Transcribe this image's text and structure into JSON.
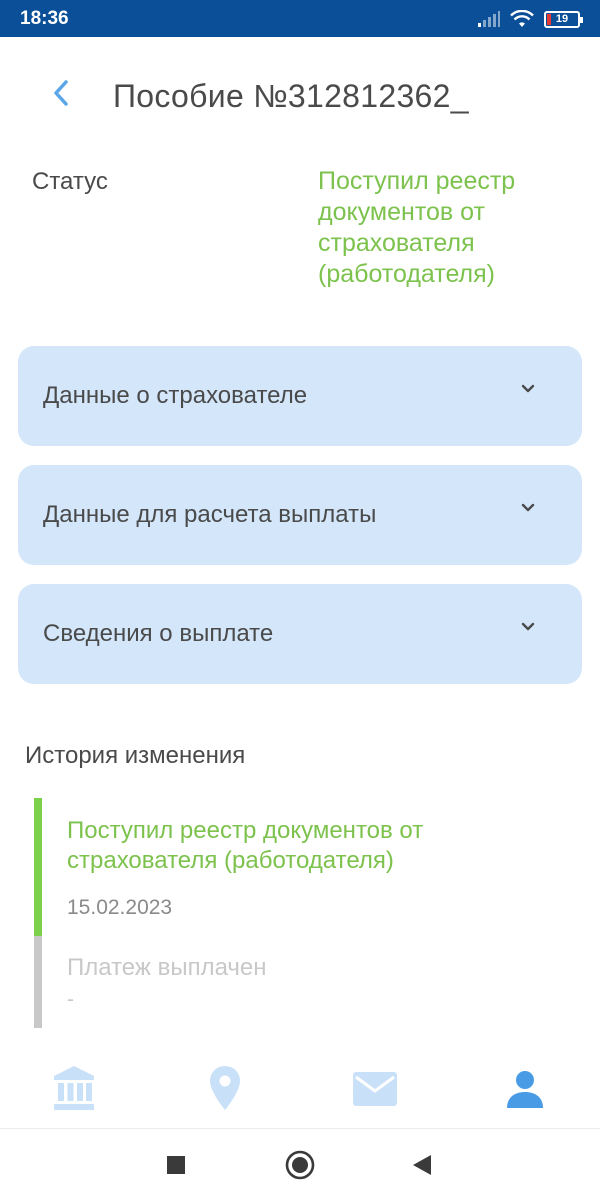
{
  "statusbar": {
    "time": "18:36",
    "battery": "19"
  },
  "header": {
    "title": "Пособие №312812362_"
  },
  "status": {
    "label": "Статус",
    "value": "Поступил реестр документов от страхователя (работодателя)"
  },
  "accordions": [
    {
      "label": "Данные о страхователе"
    },
    {
      "label": "Данные для расчета выплаты"
    },
    {
      "label": "Сведения о выплате"
    }
  ],
  "history": {
    "title": "История изменения",
    "items": [
      {
        "text": "Поступил реестр документов от страхователя (работодателя)",
        "date": "15.02.2023",
        "state": "done"
      },
      {
        "text": "Платеж выплачен",
        "date": "-",
        "state": "pending"
      }
    ]
  },
  "bottom_nav": {
    "items": [
      "bank-icon",
      "location-pin-icon",
      "mail-icon",
      "profile-icon"
    ],
    "active": "profile-icon"
  },
  "colors": {
    "statusbar": "#0a4f97",
    "accent_green": "#7cc24d",
    "accordion_bg": "#d3e6fa",
    "nav_inactive": "#c9e1f8",
    "nav_active": "#4a9be6"
  }
}
